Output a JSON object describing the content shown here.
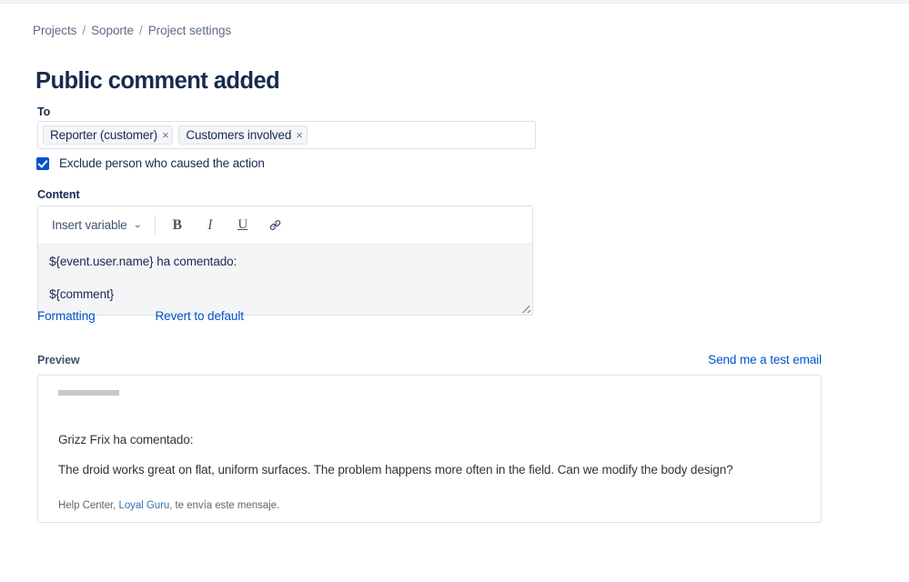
{
  "breadcrumb": {
    "items": [
      {
        "label": "Projects"
      },
      {
        "label": "Soporte"
      },
      {
        "label": "Project settings"
      }
    ],
    "separator": "/"
  },
  "page": {
    "title": "Public comment added"
  },
  "to_field": {
    "label": "To",
    "tags": [
      {
        "label": "Reporter (customer)",
        "remove_icon": "×"
      },
      {
        "label": "Customers involved",
        "remove_icon": "×"
      }
    ]
  },
  "exclude_option": {
    "label": "Exclude person who caused the action",
    "checked": true,
    "accent_color": "#0052cc"
  },
  "content": {
    "label": "Content",
    "toolbar": {
      "insert_variable_label": "Insert variable",
      "chevron": "⌄",
      "bold_label": "B",
      "italic_label": "I",
      "underline_label": "U",
      "link_icon": "link-icon"
    },
    "body_lines": [
      "${event.user.name} ha comentado:",
      "${comment}"
    ]
  },
  "actions": {
    "formatting_label": "Formatting",
    "revert_label": "Revert to default",
    "test_email_label": "Send me a test email",
    "link_color": "#0052cc"
  },
  "preview": {
    "label": "Preview",
    "greeting": "Grizz Frix ha comentado:",
    "body": "The droid works great on flat, uniform surfaces. The problem happens more often in the field. Can we modify the body design?",
    "footer_prefix": "Help Center, ",
    "footer_link": "Loyal Guru",
    "footer_suffix": ", te envía este mensaje."
  }
}
